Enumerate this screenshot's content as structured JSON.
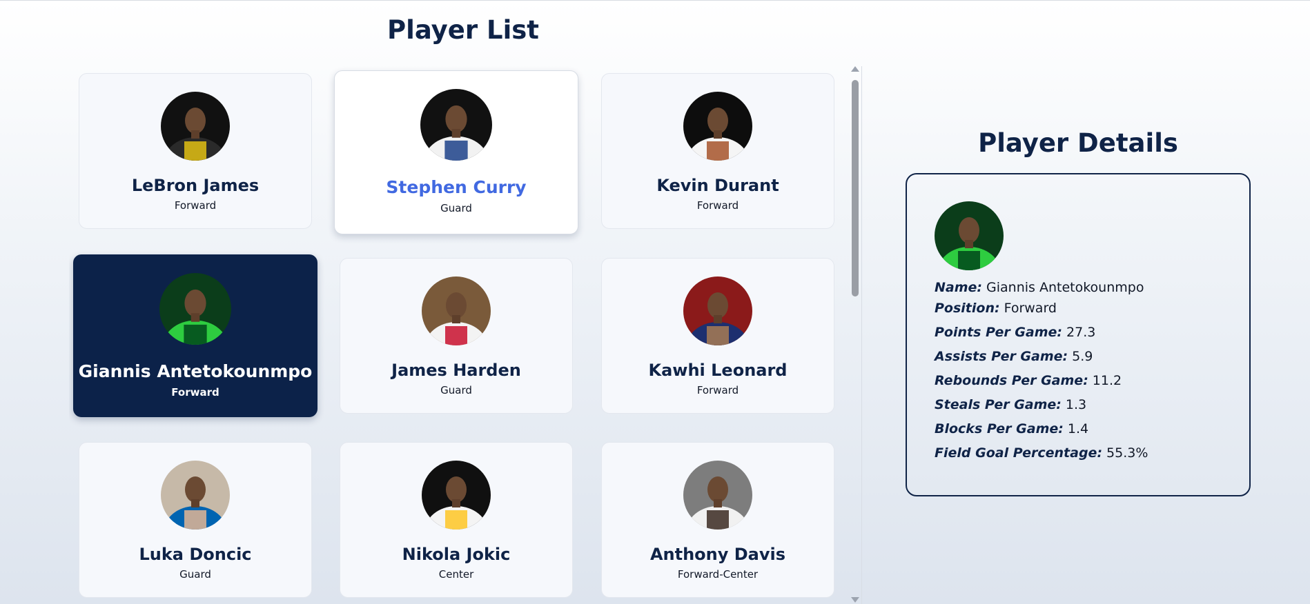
{
  "list_title": "Player List",
  "details_title": "Player Details",
  "players": [
    {
      "name": "LeBron James",
      "position": "Forward",
      "avatar_colors": [
        "#111111",
        "#2a2a2a",
        "#e2c013"
      ]
    },
    {
      "name": "Stephen Curry",
      "position": "Guard",
      "avatar_colors": [
        "#111111",
        "#f2f2f2",
        "#1d428a"
      ]
    },
    {
      "name": "Kevin Durant",
      "position": "Forward",
      "avatar_colors": [
        "#0d0d0d",
        "#f5f5f5",
        "#a6532a"
      ]
    },
    {
      "name": "Giannis Antetokounmpo",
      "position": "Forward",
      "avatar_colors": [
        "#0b3d1a",
        "#2ecc40",
        "#00471b"
      ]
    },
    {
      "name": "James Harden",
      "position": "Guard",
      "avatar_colors": [
        "#7a5a3a",
        "#f3f3f3",
        "#c8102e"
      ]
    },
    {
      "name": "Kawhi Leonard",
      "position": "Forward",
      "avatar_colors": [
        "#8b1a1a",
        "#1d2f6f",
        "#a87b54"
      ]
    },
    {
      "name": "Luka Doncic",
      "position": "Guard",
      "avatar_colors": [
        "#c6b9a8",
        "#0064b1",
        "#e3b594"
      ]
    },
    {
      "name": "Nikola Jokic",
      "position": "Center",
      "avatar_colors": [
        "#101010",
        "#f4f4f4",
        "#fec524"
      ]
    },
    {
      "name": "Anthony Davis",
      "position": "Forward-Center",
      "avatar_colors": [
        "#7d7d7d",
        "#f1f1f1",
        "#3b2a22"
      ]
    }
  ],
  "hovered_index": 1,
  "selected_index": 3,
  "details": {
    "rows": [
      {
        "label": "Name:",
        "value": "Giannis Antetokounmpo"
      },
      {
        "label": "Position:",
        "value": "Forward"
      },
      {
        "label": "Points Per Game:",
        "value": "27.3"
      },
      {
        "label": "Assists Per Game:",
        "value": "5.9"
      },
      {
        "label": "Rebounds Per Game:",
        "value": "11.2"
      },
      {
        "label": "Steals Per Game:",
        "value": "1.3"
      },
      {
        "label": "Blocks Per Game:",
        "value": "1.4"
      },
      {
        "label": "Field Goal Percentage:",
        "value": "55.3%"
      }
    ]
  },
  "colors": {
    "navy": "#0c2249",
    "hover_name": "#4169e1",
    "card_bg": "#f6f8fc"
  }
}
